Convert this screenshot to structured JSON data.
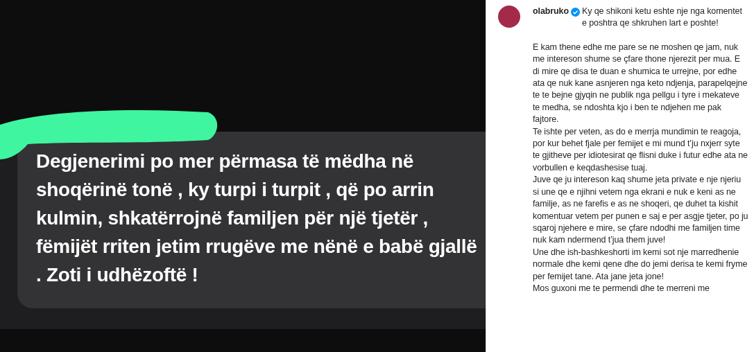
{
  "comment_screenshot": {
    "text": "Degjenerimi po mer përmasa të mëdha në shoqërinë tonë , ky turpi i turpit , që po arrin kulmin, shkatërrojnë familjen për një tjetër , fëmijët rriten jetim rrugëve me nënë e babë gjallë . Zoti i udhëzoftë !"
  },
  "post": {
    "username": "olabruko",
    "verified": true,
    "paragraphs": [
      "Ky qe shikoni ketu eshte nje nga komentet e poshtra qe shkruhen lart e poshte!",
      "E kam thene edhe me pare se ne moshen qe jam, nuk me intereson shume se çfare thone njerezit per mua. E di mire qe disa te duan e shumica te urrejne, por edhe ata qe nuk kane asnjeren nga keto ndjenja, parapelqejne te te bejne gjyqin ne publik nga pellgu i tyre i mekateve te medha, se ndoshta kjo i ben te ndjehen me pak fajtore.",
      "Te ishte per veten, as do e merrja mundimin te reagoja, por kur behet fjale per femijet e mi mund t’ju nxjerr syte te gjitheve per idiotesirat qe flisni duke i futur edhe ata ne vorbullen e keqdashesise tuaj.",
      "Juve qe ju intereson kaq shume jeta private e nje njeriu si une qe e njihni vetem nga ekrani e nuk e keni as ne familje, as ne farefis e as ne shoqeri, qe duhet ta kishit komentuar vetem per punen e saj e per asgje tjeter, po ju sqaroj njehere e mire, se çfare ndodhi me familjen time nuk kam ndermend t’jua them juve!",
      "Une dhe ish-bashkeshorti im kemi sot nje marredhenie normale dhe kemi qene dhe do jemi derisa te kemi fryme per femijet tane. Ata jane jeta jone!",
      "Mos guxoni me te permendi dhe te merreni me"
    ]
  }
}
